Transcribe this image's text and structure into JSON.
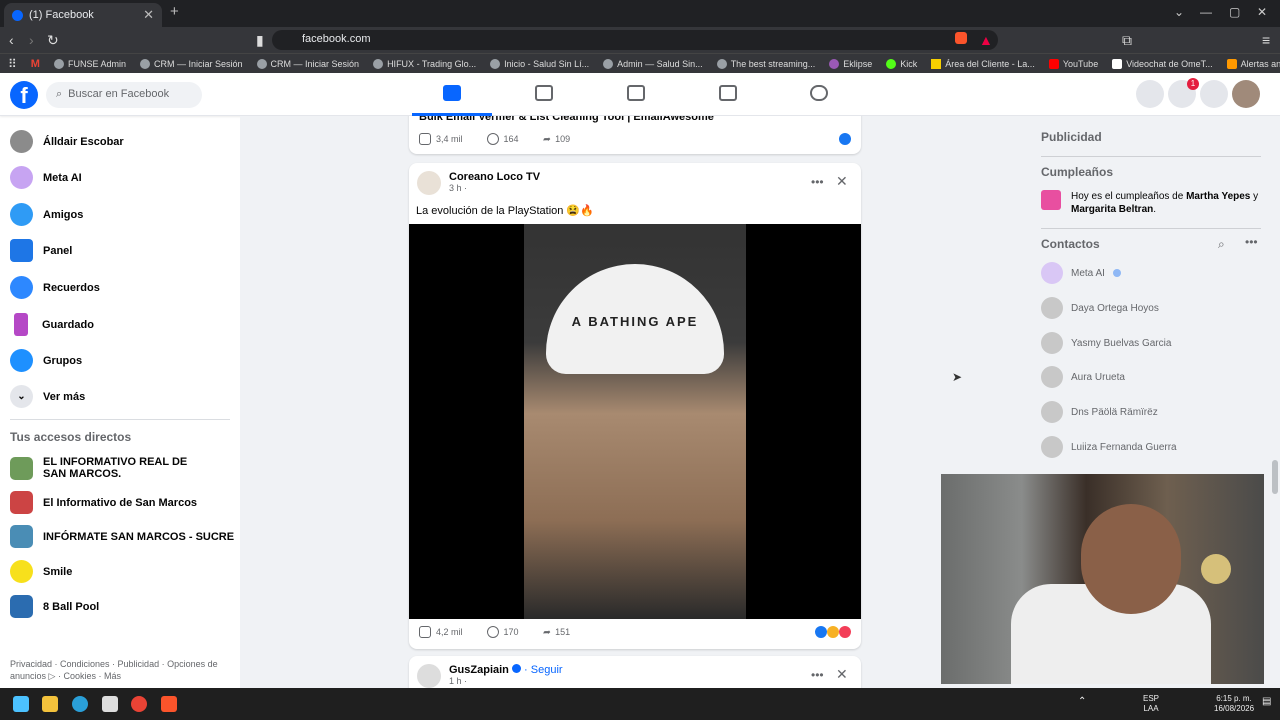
{
  "browser": {
    "tab_title": "(1) Facebook",
    "url": "facebook.com",
    "bookmarks": [
      "FUNSE Admin",
      "CRM — Iniciar Sesión",
      "CRM — Iniciar Sesión",
      "HIFUX - Trading Glo...",
      "Inicio - Salud Sin Lí...",
      "Admin — Salud Sin...",
      "The best streaming...",
      "Eklipse",
      "Kick",
      "Área del Cliente - La...",
      "YouTube",
      "Videochat de OmeT...",
      "Alertas animadas de..."
    ]
  },
  "fb": {
    "search_placeholder": "Buscar en Facebook",
    "notif_count": "1"
  },
  "left": {
    "items": [
      {
        "label": "Álldair Escobar",
        "color": "#8b8b8b"
      },
      {
        "label": "Meta AI",
        "color": "#a56ee6"
      },
      {
        "label": "Amigos",
        "color": "#2f9bf5"
      },
      {
        "label": "Panel",
        "color": "#1e76e6"
      },
      {
        "label": "Recuerdos",
        "color": "#2d88ff"
      },
      {
        "label": "Guardado",
        "color": "#b548c6"
      },
      {
        "label": "Grupos",
        "color": "#1e90ff"
      },
      {
        "label": "Ver más",
        "color": "#e4e6eb"
      }
    ],
    "shortcuts_title": "Tus accesos directos",
    "shortcuts": [
      {
        "label": "EL INFORMATIVO REAL DE SAN MARCOS."
      },
      {
        "label": "El Informativo de San Marcos"
      },
      {
        "label": "INFÓRMATE SAN MARCOS - SUCRE"
      },
      {
        "label": "Smile"
      },
      {
        "label": "8 Ball Pool"
      }
    ],
    "footer": "Privacidad · Condiciones · Publicidad · Opciones de anuncios ▷ · Cookies · Más"
  },
  "post1": {
    "title_fragment": "Bulk Email Verifier & List Cleaning Tool | EmailAwesome",
    "likes": "3,4 mil",
    "comments": "164",
    "shares": "109"
  },
  "post2": {
    "author": "Coreano Loco TV",
    "time": "3 h ·",
    "text": "La evolución de la PlayStation 😫🔥",
    "cap_text": "A BATHING APE",
    "likes": "4,2 mil",
    "comments": "170",
    "shares": "151"
  },
  "post3": {
    "author": "GusZapiain",
    "follow": "· Seguir",
    "time": "1 h ·"
  },
  "right": {
    "ads": "Publicidad",
    "birthdays": "Cumpleaños",
    "birthday_pre": "Hoy es el cumpleaños de ",
    "birthday_name1": "Martha Yepes",
    "birthday_mid": " y ",
    "birthday_name2": "Margarita Beltran",
    "birthday_post": ".",
    "contacts_title": "Contactos",
    "contacts": [
      {
        "name": "Meta AI"
      },
      {
        "name": "Daya Ortega Hoyos"
      },
      {
        "name": "Yasmy Buelvas Garcia"
      },
      {
        "name": "Aura Urueta"
      },
      {
        "name": "Dns Päölä Rämïrëz"
      },
      {
        "name": "Luiiza Fernanda Guerra"
      }
    ]
  },
  "taskbar": {
    "lang": "ESP",
    "kbd": "LAA",
    "time": "6:15 p. m.",
    "date": "16/08/2026"
  }
}
